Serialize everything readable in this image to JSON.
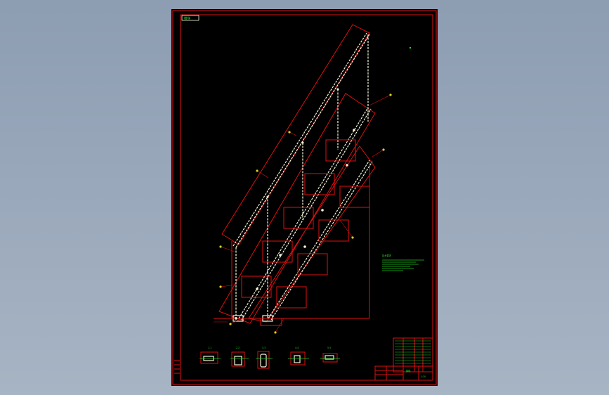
{
  "drawing": {
    "title_tag": "楼梯",
    "background_color": "#000000",
    "frame_color": "#e01010",
    "geometry_color": "#f4f4d8",
    "annotation_color": "#1ec81e",
    "viewport_color": "#9aa9bb"
  },
  "section_views": [
    {
      "label": "1-1"
    },
    {
      "label": "2-2"
    },
    {
      "label": "3-3"
    },
    {
      "label": "4-4"
    },
    {
      "label": "5-5"
    }
  ],
  "notes": {
    "heading": "技术要求"
  },
  "title_block": {
    "name": "楼梯",
    "scale": "1:20"
  }
}
